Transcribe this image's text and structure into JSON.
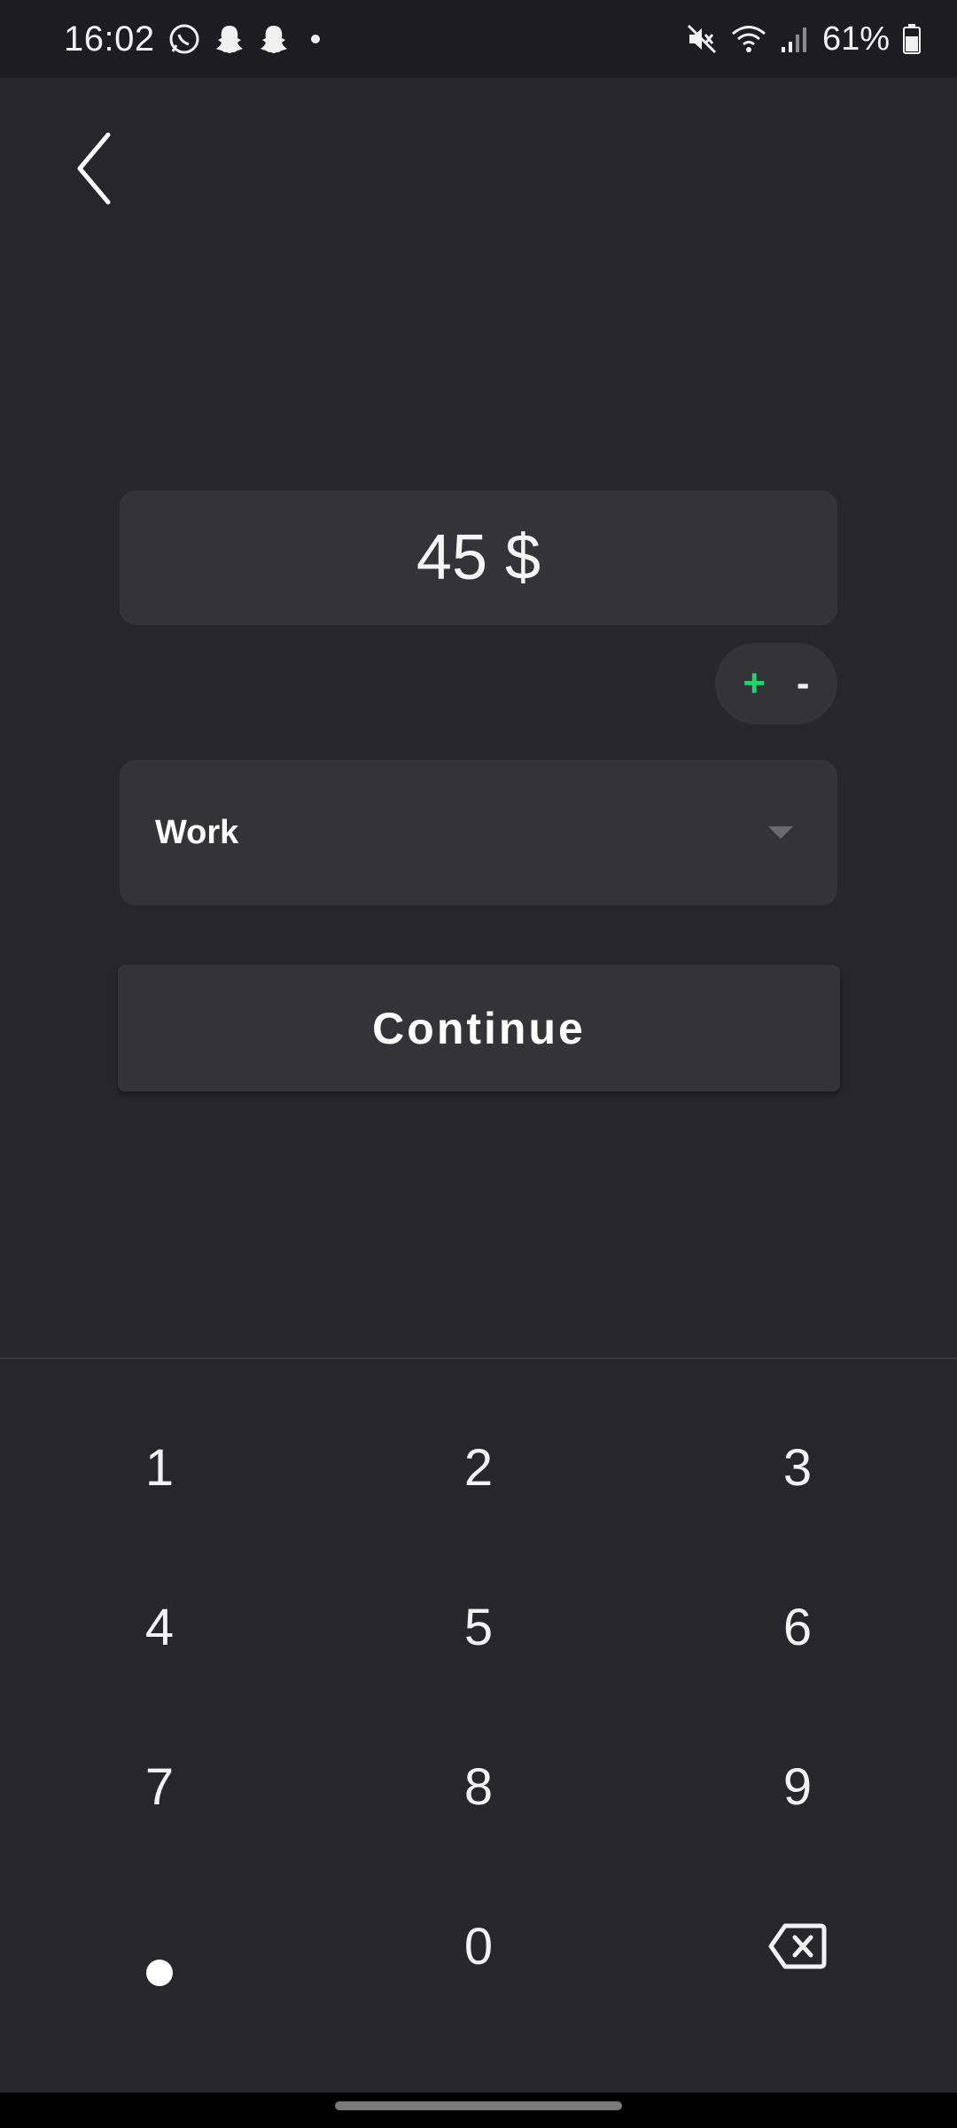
{
  "status_bar": {
    "time": "16:02",
    "battery_percent": "61%",
    "left_icons": [
      "whatsapp-icon",
      "snapchat-icon",
      "snapchat-icon",
      "dot-icon"
    ],
    "right_icons": [
      "mute-icon",
      "wifi-icon",
      "signal-icon",
      "battery-icon"
    ]
  },
  "amount": {
    "value": "45",
    "currency": "$"
  },
  "sign_toggle": {
    "plus": "+",
    "minus": "-"
  },
  "category": {
    "selected": "Work"
  },
  "actions": {
    "continue_label": "Continue"
  },
  "keypad": {
    "keys": [
      "1",
      "2",
      "3",
      "4",
      "5",
      "6",
      "7",
      "8",
      "9",
      "",
      "0",
      ""
    ],
    "special": {
      "decimal": "dot",
      "backspace": "backspace-icon"
    }
  },
  "colors": {
    "background": "#26262b",
    "surface": "#333338",
    "accent_plus": "#22d36b",
    "text": "#ffffff"
  }
}
